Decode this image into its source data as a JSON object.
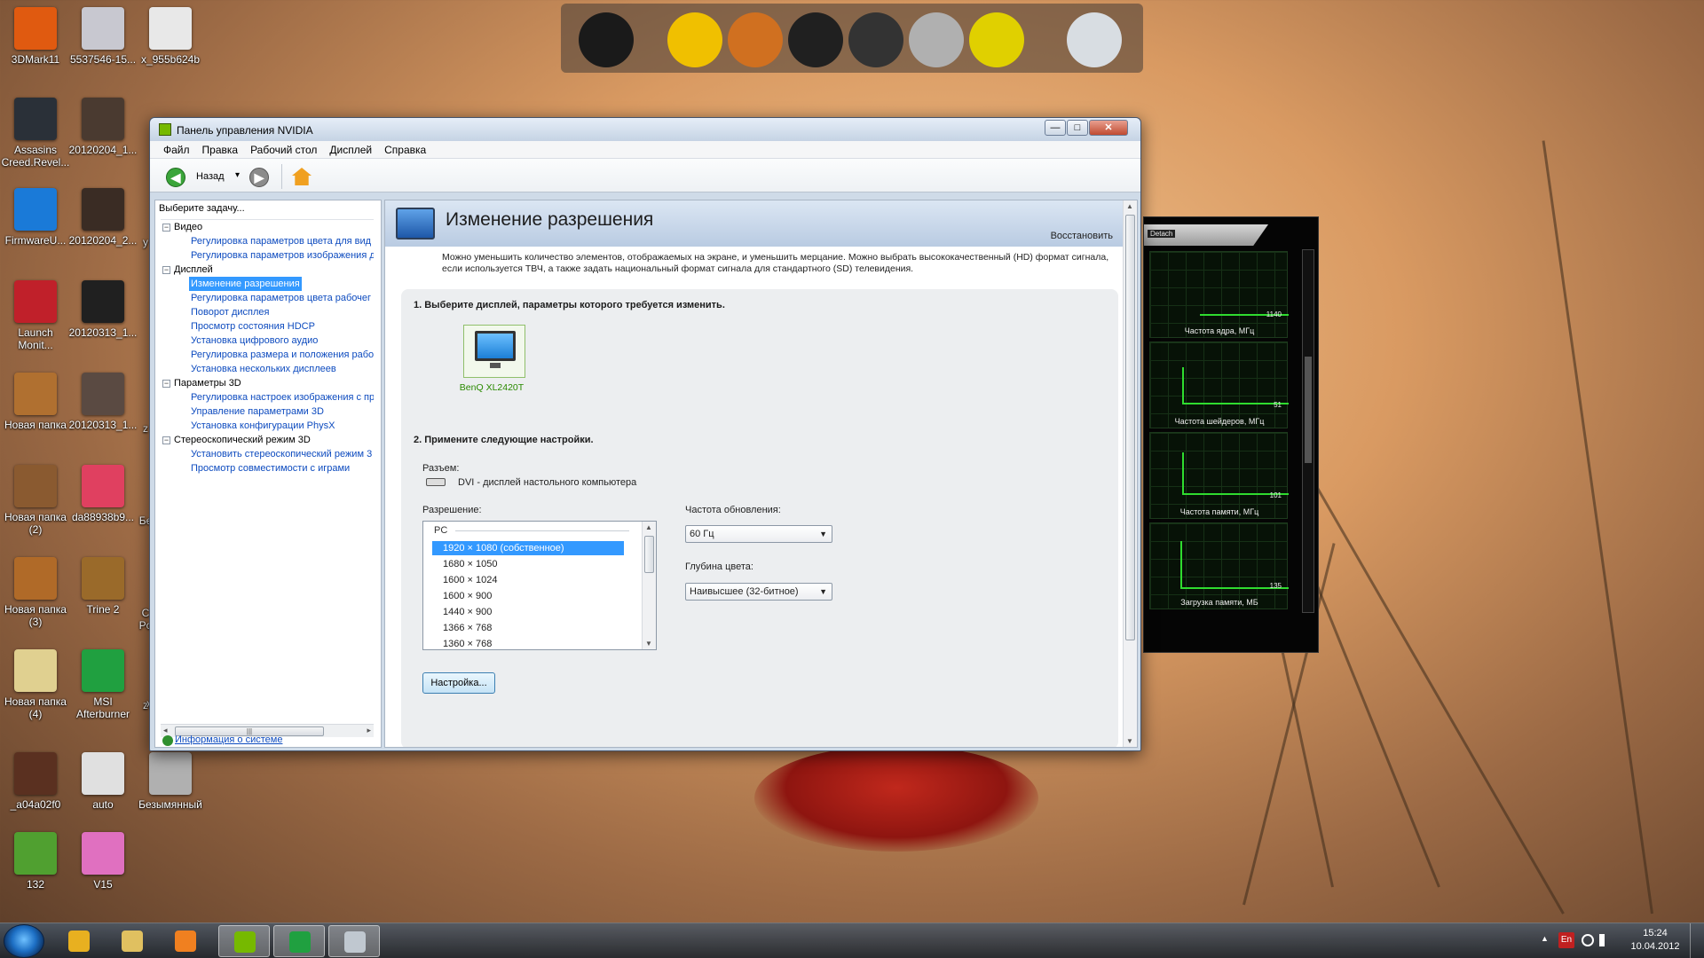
{
  "desktop": {
    "icons": [
      {
        "label": "3DMark11",
        "color": "#e05a10"
      },
      {
        "label": "5537546-15...",
        "color": "#c8c8d0"
      },
      {
        "label": "x_955b624b",
        "color": "#e8e8e8"
      },
      {
        "label": "Assasins Creed.Revel...",
        "color": "#2a3038"
      },
      {
        "label": "20120204_1...",
        "color": "#4a3a30"
      },
      {
        "label": "FirmwareU...",
        "color": "#1a7ad8"
      },
      {
        "label": "20120204_2...",
        "color": "#3a2c24"
      },
      {
        "label": "Launch Monit...",
        "color": "#c0202a"
      },
      {
        "label": "20120313_1...",
        "color": "#202020"
      },
      {
        "label": "Новая папка",
        "color": "#b07030"
      },
      {
        "label": "20120313_1...",
        "color": "#5a4a42"
      },
      {
        "label": "Новая папка (2)",
        "color": "#8a5a30"
      },
      {
        "label": "da88938b9...",
        "color": "#e04060"
      },
      {
        "label": "Новая папка (3)",
        "color": "#b06a28"
      },
      {
        "label": "Trine 2",
        "color": "#9a6a2a"
      },
      {
        "label": "Новая папка (4)",
        "color": "#e0d090"
      },
      {
        "label": "MSI Afterburner",
        "color": "#20a040"
      },
      {
        "label": "_a04a02f0",
        "color": "#5a3020"
      },
      {
        "label": "auto",
        "color": "#e0e0e0"
      },
      {
        "label": "Безымянный",
        "color": "#b0b0b0"
      },
      {
        "label": "132",
        "color": "#50a030"
      },
      {
        "label": "V15",
        "color": "#e070c0"
      }
    ],
    "partial_labels": [
      "y",
      "z",
      "Бе",
      "C Po",
      "z",
      "x"
    ]
  },
  "dock": {
    "items": [
      {
        "icon": "monitor-icon",
        "color": "#1a1a1a"
      },
      {
        "icon": "road-sign-icon",
        "color": "#f0c000"
      },
      {
        "icon": "photos-icon",
        "color": "#d07020"
      },
      {
        "icon": "film-reel-icon",
        "color": "#202020"
      },
      {
        "icon": "speaker-icon",
        "color": "#333333"
      },
      {
        "icon": "tools-icon",
        "color": "#b0b0b0"
      },
      {
        "icon": "radiation-icon",
        "color": "#e0d000"
      },
      {
        "icon": "trash-icon",
        "color": "#d8dde2"
      }
    ]
  },
  "window": {
    "title": "Панель управления NVIDIA",
    "controls": {
      "minimize": "—",
      "maximize": "□",
      "close": "✕"
    },
    "menu": [
      "Файл",
      "Правка",
      "Рабочий стол",
      "Дисплей",
      "Справка"
    ],
    "toolbar": {
      "back_label": "Назад",
      "dropdown": "▾"
    },
    "left_pane": {
      "header": "Выберите задачу...",
      "tree": [
        {
          "type": "cat",
          "label": "Видео",
          "sign": "−"
        },
        {
          "type": "leaf",
          "label": "Регулировка параметров цвета для вид"
        },
        {
          "type": "leaf",
          "label": "Регулировка параметров изображения д"
        },
        {
          "type": "cat",
          "label": "Дисплей",
          "sign": "−"
        },
        {
          "type": "leaf",
          "label": "Изменение разрешения",
          "selected": true
        },
        {
          "type": "leaf",
          "label": "Регулировка параметров цвета рабочег"
        },
        {
          "type": "leaf",
          "label": "Поворот дисплея"
        },
        {
          "type": "leaf",
          "label": "Просмотр состояния HDCP"
        },
        {
          "type": "leaf",
          "label": "Установка цифрового аудио"
        },
        {
          "type": "leaf",
          "label": "Регулировка размера и положения рабо"
        },
        {
          "type": "leaf",
          "label": "Установка нескольких дисплеев"
        },
        {
          "type": "cat",
          "label": "Параметры 3D",
          "sign": "−"
        },
        {
          "type": "leaf",
          "label": "Регулировка настроек изображения с пр"
        },
        {
          "type": "leaf",
          "label": "Управление параметрами 3D"
        },
        {
          "type": "leaf",
          "label": "Установка конфигурации PhysX"
        },
        {
          "type": "cat",
          "label": "Стереоскопический режим 3D",
          "sign": "−"
        },
        {
          "type": "leaf",
          "label": "Установить стереоскопический режим 3"
        },
        {
          "type": "leaf",
          "label": "Просмотр совместимости с играми"
        }
      ],
      "scroll_grip": "|||",
      "system_info": "Информация о системе"
    },
    "content": {
      "title": "Изменение разрешения",
      "restore": "Восстановить",
      "description": "Можно уменьшить количество элементов, отображаемых на экране, и уменьшить мерцание. Можно выбрать высококачественный (HD) формат сигнала, если используется ТВЧ, а также задать национальный формат сигнала для стандартного (SD) телевидения.",
      "step1": "1. Выберите дисплей, параметры которого требуется изменить.",
      "display_name": "BenQ XL2420T",
      "step2": "2. Примените следующие настройки.",
      "connector_label": "Разъем:",
      "connector_value": "DVI - дисплей настольного компьютера",
      "resolution_label": "Разрешение:",
      "resolution_group": "PC",
      "resolutions": [
        "1920 × 1080 (собственное)",
        "1680 × 1050",
        "1600 × 1024",
        "1600 × 900",
        "1440 × 900",
        "1366 × 768",
        "1360 × 768"
      ],
      "resolution_selected": 0,
      "refresh_label": "Частота обновления:",
      "refresh_value": "60 Гц",
      "depth_label": "Глубина цвета:",
      "depth_value": "Наивысшее (32-битное)",
      "customize_button": "Настройка..."
    }
  },
  "afterburner": {
    "detach": "Detach",
    "graphs": [
      {
        "label": "Частота ядра, МГц",
        "value": "1140"
      },
      {
        "label": "Частота шейдеров, МГц",
        "value": "51"
      },
      {
        "label": "Частота памяти, МГц",
        "value": "101"
      },
      {
        "label": "Загрузка памяти, МБ",
        "value": "135"
      }
    ]
  },
  "taskbar": {
    "apps": [
      {
        "icon": "chrome-icon",
        "color": "#e8b020"
      },
      {
        "icon": "folder-icon",
        "color": "#e0c060"
      },
      {
        "icon": "media-player-icon",
        "color": "#f08020"
      },
      {
        "icon": "nvidia-icon",
        "color": "#76b900",
        "active": true
      },
      {
        "icon": "msi-afterburner-icon",
        "color": "#20a040",
        "active": true
      },
      {
        "icon": "tools-app-icon",
        "color": "#c0c8d0",
        "active": true
      }
    ],
    "tray": {
      "show_hidden": "▲",
      "lang": "En"
    },
    "time": "15:24",
    "date": "10.04.2012"
  }
}
